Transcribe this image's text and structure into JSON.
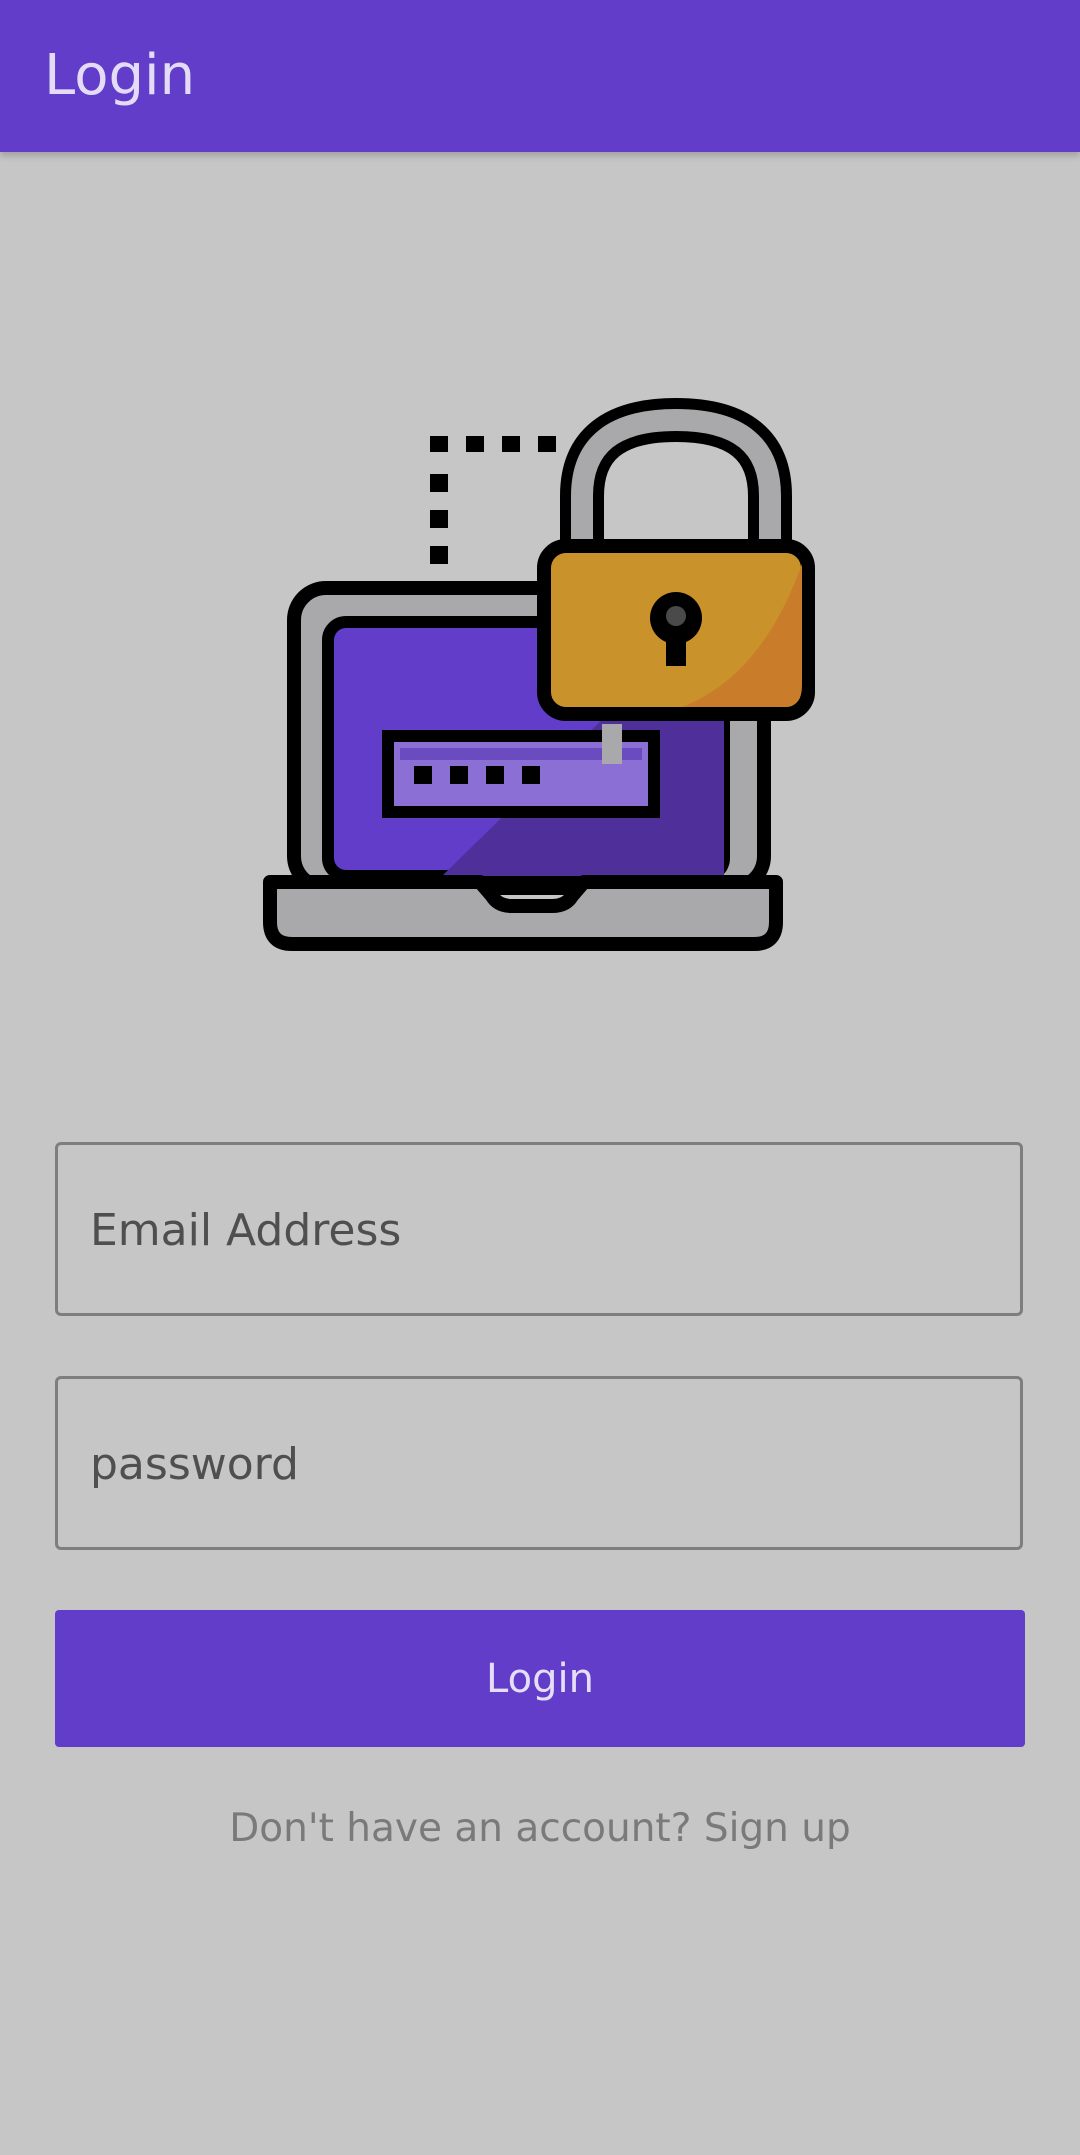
{
  "appbar": {
    "title": "Login"
  },
  "illustration": {
    "icon": "laptop-padlock-icon"
  },
  "form": {
    "email_placeholder": "Email Address",
    "email_value": "",
    "password_placeholder": "password",
    "password_value": "",
    "login_label": "Login",
    "signup_text": "Don't have an account? Sign up"
  },
  "colors": {
    "primary": "#613dc9",
    "background": "#c6c6c6",
    "lock_gold": "#c9922a",
    "field_border": "#7e7e7e"
  }
}
